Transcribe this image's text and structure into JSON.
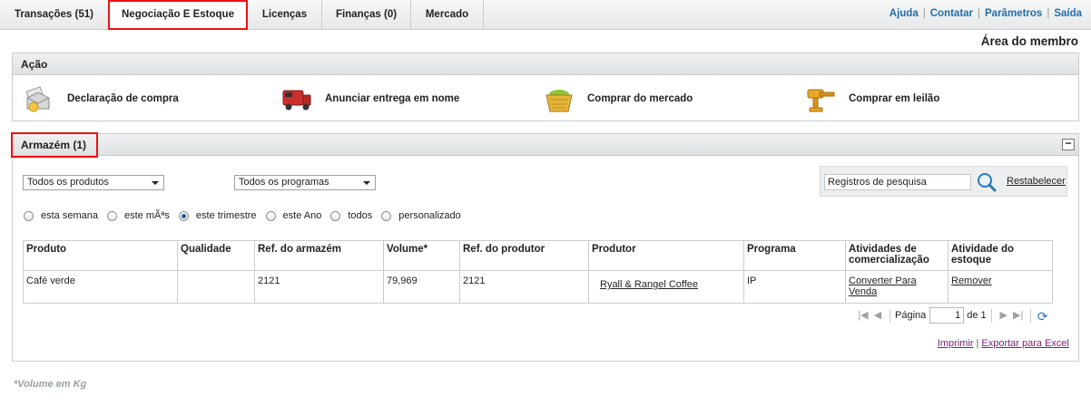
{
  "nav": {
    "tabs": [
      {
        "label": "Transações (51)"
      },
      {
        "label": "Negociação E Estoque"
      },
      {
        "label": "Licenças"
      },
      {
        "label": "Finanças (0)"
      },
      {
        "label": "Mercado"
      }
    ],
    "active_tab": "Negociação E Estoque",
    "links": [
      "Ajuda",
      "Contatar",
      "Parâmetros",
      "Saída"
    ]
  },
  "member_area": "Área do membro",
  "actions_panel": {
    "title": "Ação",
    "items": [
      {
        "label": "Declaração de compra",
        "icon": "envelope-document-icon"
      },
      {
        "label": "Anunciar entrega em nome",
        "icon": "truck-icon"
      },
      {
        "label": "Comprar do mercado",
        "icon": "basket-icon"
      },
      {
        "label": "Comprar em leilão",
        "icon": "gavel-icon"
      }
    ]
  },
  "warehouse": {
    "title": "Armazém (1)",
    "collapse_label": "−",
    "product_filter": "Todos os produtos",
    "program_filter": "Todos os programas",
    "search_value": "Registros de pesquisa",
    "reset_label": "Restabelecer",
    "periods": [
      {
        "label": "esta semana",
        "selected": false
      },
      {
        "label": "este mÃªs",
        "selected": false
      },
      {
        "label": "este trimestre",
        "selected": true
      },
      {
        "label": "este Ano",
        "selected": false
      },
      {
        "label": "todos",
        "selected": false
      },
      {
        "label": "personalizado",
        "selected": false
      }
    ],
    "columns": [
      "Produto",
      "Qualidade",
      "Ref. do armazém",
      "Volume*",
      "Ref. do produtor",
      "Produtor",
      "Programa",
      "Atividades de comercialização",
      "Atividade do estoque"
    ],
    "rows": [
      {
        "produto": "Café verde",
        "qualidade": "",
        "ref_armazem": "2121",
        "volume": "79,969",
        "ref_produtor": "2121",
        "produtor": "Ryall & Rangel Coffee",
        "programa": "IP",
        "atividade_comercial": "Converter Para Venda",
        "atividade_estoque": "Remover"
      }
    ],
    "pager": {
      "label": "Página",
      "current": "1",
      "of_label": "de 1"
    },
    "export_links": [
      "Imprimir",
      "Exportar para Excel"
    ]
  },
  "footnote": "*Volume em Kg"
}
